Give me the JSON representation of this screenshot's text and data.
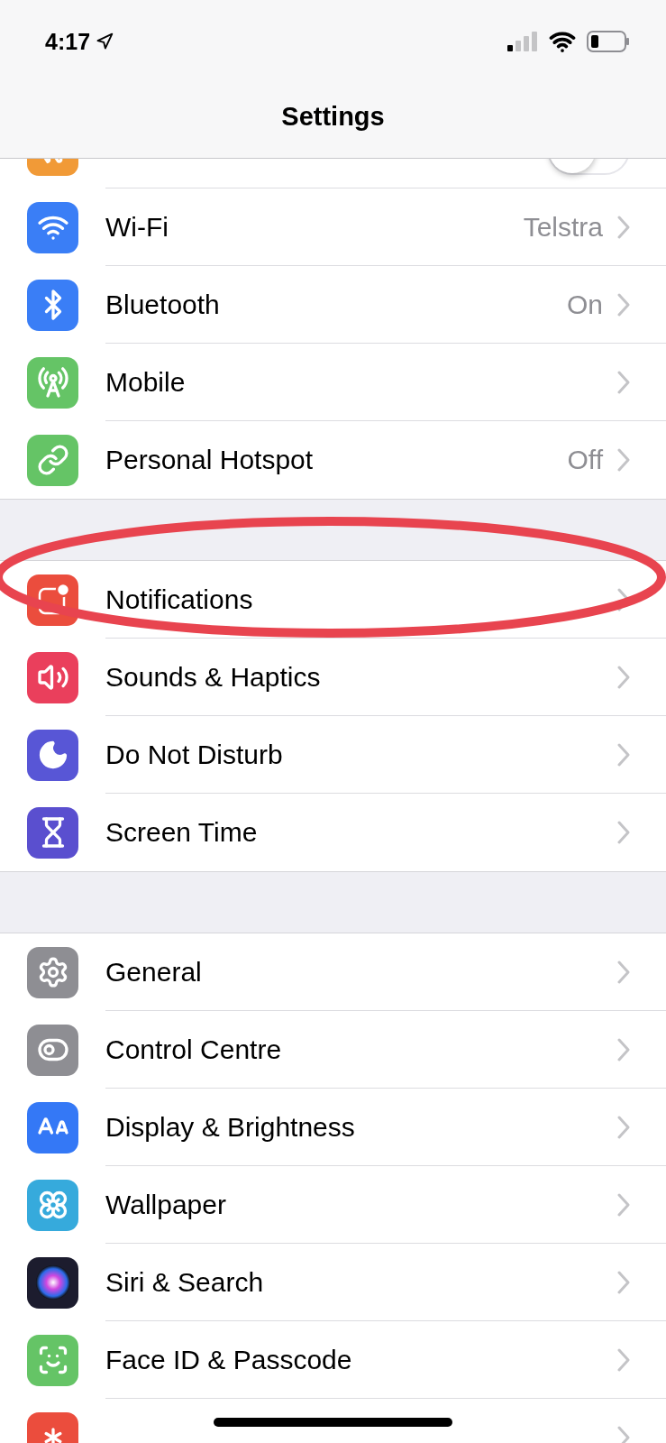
{
  "status_bar": {
    "time": "4:17"
  },
  "title": "Settings",
  "groups": [
    {
      "rows": [
        {
          "kind": "toggle",
          "color": "#f19a37",
          "on": false
        },
        {
          "kind": "link",
          "label": "Wi-Fi",
          "value": "Telstra",
          "color": "#3a7ef6"
        },
        {
          "kind": "link",
          "label": "Bluetooth",
          "value": "On",
          "color": "#3a7ef6"
        },
        {
          "kind": "link",
          "label": "Mobile",
          "color": "#65c466"
        },
        {
          "kind": "link",
          "label": "Personal Hotspot",
          "value": "Off",
          "color": "#65c466"
        }
      ]
    },
    {
      "rows": [
        {
          "kind": "link",
          "label": "Notifications",
          "color": "#eb4d3d"
        },
        {
          "kind": "link",
          "label": "Sounds & Haptics",
          "color": "#ea3f5c"
        },
        {
          "kind": "link",
          "label": "Do Not Disturb",
          "color": "#5856d6"
        },
        {
          "kind": "link",
          "label": "Screen Time",
          "color": "#5a4fcf"
        }
      ]
    },
    {
      "rows": [
        {
          "kind": "link",
          "label": "General",
          "color": "#8e8e93"
        },
        {
          "kind": "link",
          "label": "Control Centre",
          "color": "#8e8e93"
        },
        {
          "kind": "link",
          "label": "Display & Brightness",
          "color": "#3478f6"
        },
        {
          "kind": "link",
          "label": "Wallpaper",
          "color": "#36aadc"
        },
        {
          "kind": "link",
          "label": "Siri & Search",
          "color": "#1c1c2e"
        },
        {
          "kind": "link",
          "label": "Face ID & Passcode",
          "color": "#65c466"
        },
        {
          "kind": "link",
          "color": "#eb4d3d"
        }
      ]
    }
  ]
}
